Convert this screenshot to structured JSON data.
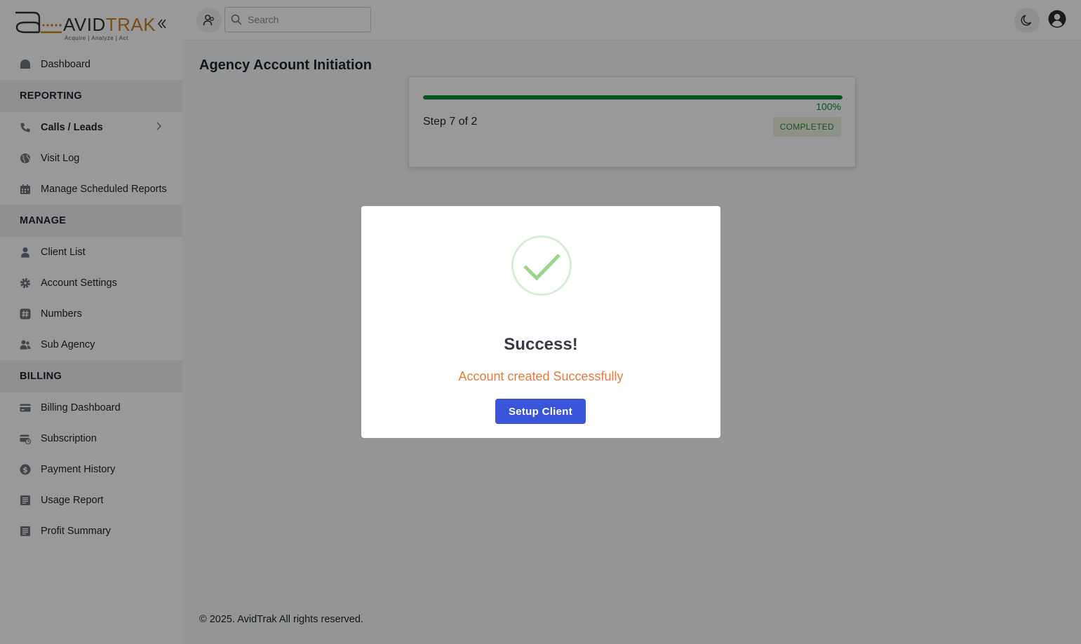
{
  "brand": {
    "name_part1": "AVID",
    "name_part2": "TRAK",
    "tagline": "Acquire  |  Analyze  |  Act",
    "collapse_icon": "chevrons-left-icon"
  },
  "sidebar": {
    "items": [
      {
        "type": "item",
        "label": "Dashboard",
        "icon": "dashboard-icon"
      },
      {
        "type": "section",
        "label": "REPORTING"
      },
      {
        "type": "item",
        "label": "Calls / Leads",
        "icon": "phone-icon",
        "bold": true,
        "has_submenu": true
      },
      {
        "type": "item",
        "label": "Visit Log",
        "icon": "globe-icon"
      },
      {
        "type": "item",
        "label": "Manage Scheduled Reports",
        "icon": "calendar-icon"
      },
      {
        "type": "section",
        "label": "MANAGE"
      },
      {
        "type": "item",
        "label": "Client List",
        "icon": "user-icon"
      },
      {
        "type": "item",
        "label": "Account Settings",
        "icon": "gear-icon"
      },
      {
        "type": "item",
        "label": "Numbers",
        "icon": "hash-icon"
      },
      {
        "type": "item",
        "label": "Sub Agency",
        "icon": "users-icon"
      },
      {
        "type": "section",
        "label": "BILLING"
      },
      {
        "type": "item",
        "label": "Billing Dashboard",
        "icon": "credit-card-icon"
      },
      {
        "type": "item",
        "label": "Subscription",
        "icon": "card-clock-icon"
      },
      {
        "type": "item",
        "label": "Payment History",
        "icon": "dollar-circle-icon"
      },
      {
        "type": "item",
        "label": "Usage Report",
        "icon": "report-icon"
      },
      {
        "type": "item",
        "label": "Profit Summary",
        "icon": "report-icon"
      }
    ]
  },
  "header": {
    "search_placeholder": "Search",
    "agency_icon": "agency-switch-icon",
    "theme_icon": "moon-icon",
    "user_icon": "user-circle-icon"
  },
  "main": {
    "title": "Agency Account Initiation",
    "progress": {
      "percent_value": 100,
      "percent_label": "100%",
      "step_text": "Step 7 of 2",
      "status": "COMPLETED"
    },
    "footer": "© 2025. AvidTrak All rights reserved."
  },
  "modal": {
    "icon": "success-check-icon",
    "title": "Success!",
    "message": "Account created Successfully",
    "button_label": "Setup Client"
  },
  "colors": {
    "accent": "#3a55d9",
    "success": "#0f8a3a",
    "message": "#ea7a3c",
    "brand_orange": "#c8831e"
  }
}
